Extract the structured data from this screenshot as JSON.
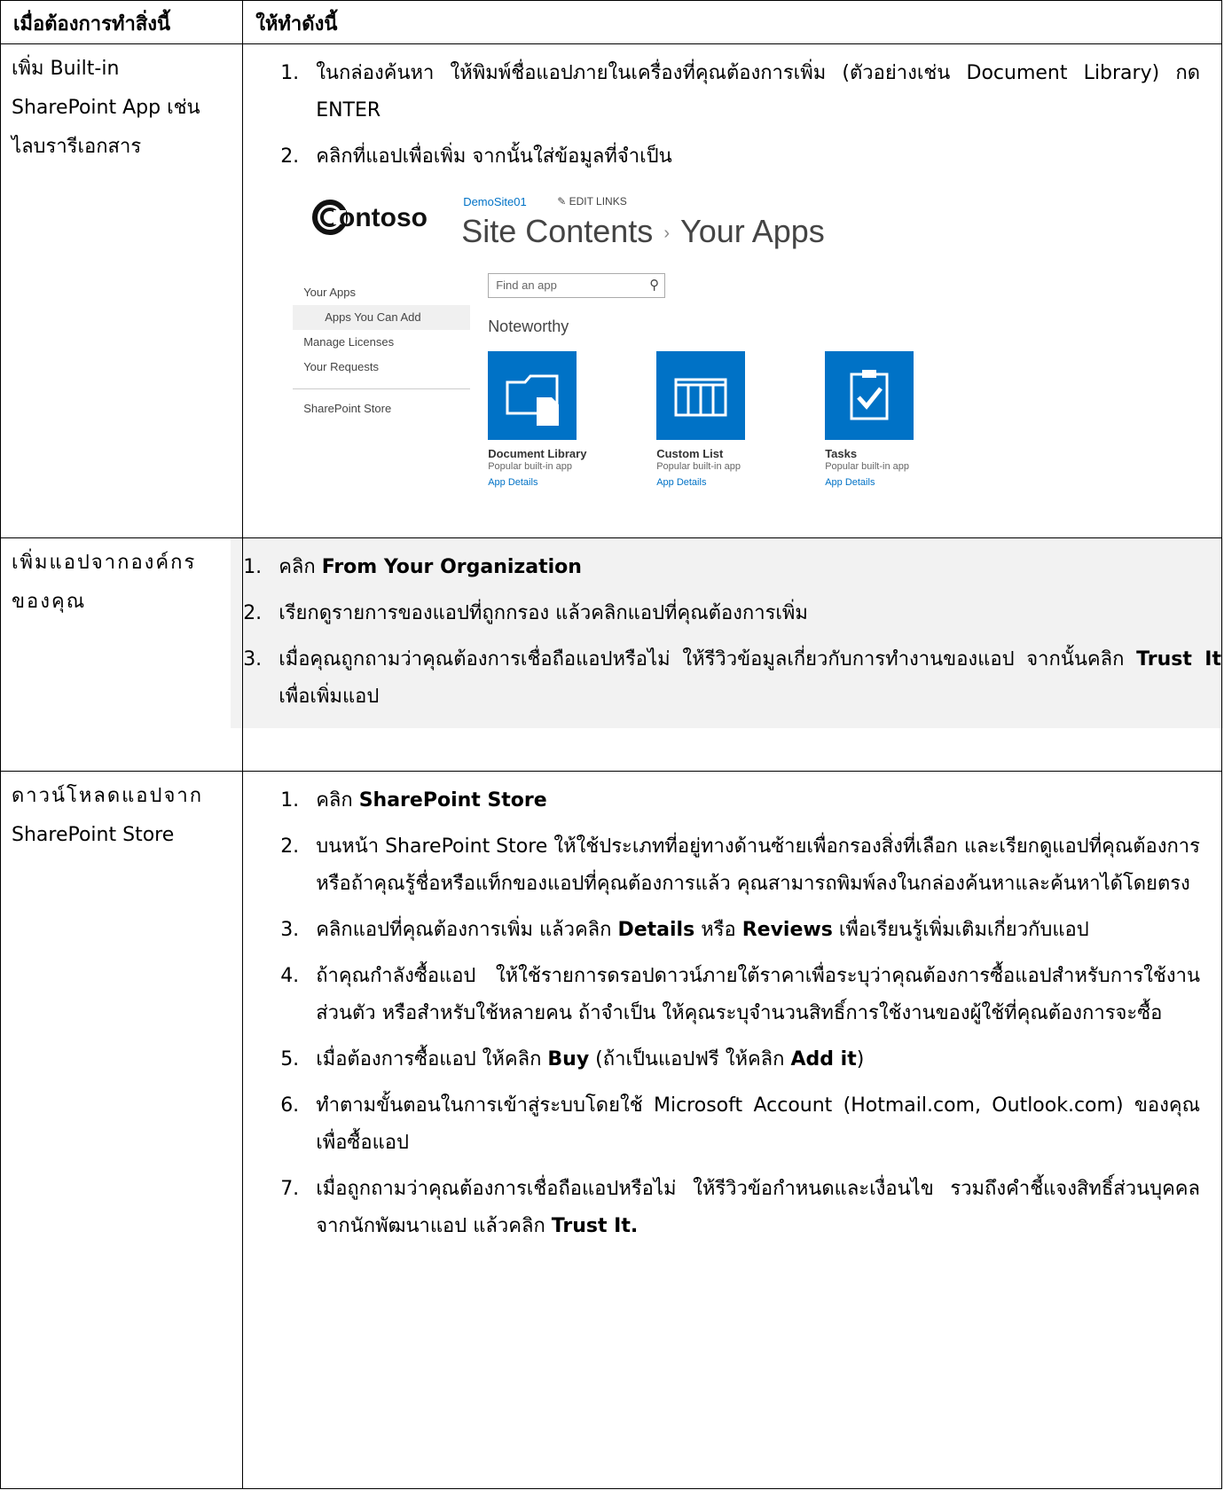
{
  "header": {
    "col1": "เมื่อต้องการทำสิ่งนี้",
    "col2": "ให้ทำดังนี้"
  },
  "rows": [
    {
      "what": [
        "เพิ่ม Built-in",
        "SharePoint App เช่น",
        "ไลบรารีเอกสาร"
      ],
      "steps": [
        {
          "num": "1.",
          "text": "ในกล่องค้นหา ให้พิมพ์ชื่อแอปภายในเครื่องที่คุณต้องการเพิ่ม (ตัวอย่างเช่น Document Library) กด ENTER"
        },
        {
          "num": "2.",
          "text": "คลิกที่แอปเพื่อเพิ่ม จากนั้นใส่ข้อมูลที่จำเป็น"
        }
      ]
    },
    {
      "what": [
        "เพิ่มแอปจากองค์กร",
        "ของคุณ"
      ],
      "steps": [
        {
          "num": "1.",
          "pre": "คลิก ",
          "bold": "From Your Organization",
          "post": ""
        },
        {
          "num": "2.",
          "pre": "เรียกดูรายการของแอปที่ถูกกรอง แล้วคลิกแอปที่คุณต้องการเพิ่ม",
          "bold": "",
          "post": ""
        },
        {
          "num": "3.",
          "pre": "เมื่อคุณถูกถามว่าคุณต้องการเชื่อถือแอปหรือไม่ ให้รีวิวข้อมูลเกี่ยวกับการทำงานของแอป จากนั้นคลิก ",
          "bold": "Trust It",
          "post": " เพื่อเพิ่มแอป"
        }
      ]
    },
    {
      "what": [
        "ดาวน์โหลดแอปจาก",
        "SharePoint Store"
      ],
      "steps": [
        {
          "num": "1.",
          "pre": "คลิก ",
          "bold": "SharePoint Store",
          "post": ""
        },
        {
          "num": "2.",
          "pre": "บนหน้า SharePoint Store ให้ใช้ประเภทที่อยู่ทางด้านซ้ายเพื่อกรองสิ่งที่เลือก และเรียกดูแอปที่คุณต้องการ",
          "bold": "",
          "post": "",
          "extra": "หรือถ้าคุณรู้ชื่อหรือแท็กของแอปที่คุณต้องการแล้ว คุณสามารถพิมพ์ลงในกล่องค้นหาและค้นหาได้โดยตรง"
        },
        {
          "num": "3.",
          "pre": "คลิกแอปที่คุณต้องการเพิ่ม แล้วคลิก ",
          "bold": "Details",
          "mid": " หรือ ",
          "bold2": "Reviews",
          "post": " เพื่อเรียนรู้เพิ่มเติมเกี่ยวกับแอป"
        },
        {
          "num": "4.",
          "pre": "ถ้าคุณกำลังซื้อแอป ให้ใช้รายการดรอปดาวน์ภายใต้ราคาเพื่อระบุว่าคุณต้องการซื้อแอปสำหรับการใช้งานส่วนตัว หรือสำหรับใช้หลายคน ถ้าจำเป็น ให้คุณระบุจำนวนสิทธิ์การใช้งานของผู้ใช้ที่คุณต้องการจะซื้อ",
          "bold": "",
          "post": ""
        },
        {
          "num": "5.",
          "pre": "เมื่อต้องการซื้อแอป ให้คลิก ",
          "bold": "Buy",
          "mid": " (ถ้าเป็นแอปฟรี ให้คลิก ",
          "bold2": "Add it",
          "post": ")"
        },
        {
          "num": "6.",
          "pre": "ทำตามขั้นตอนในการเข้าสู่ระบบโดยใช้ Microsoft Account (Hotmail.com, Outlook.com) ของคุณเพื่อซื้อแอป",
          "bold": "",
          "post": ""
        },
        {
          "num": "7.",
          "pre": "เมื่อถูกถามว่าคุณต้องการเชื่อถือแอปหรือไม่ ให้รีวิวข้อกำหนดและเงื่อนไข รวมถึงคำชี้แจงสิทธิ์ส่วนบุคคลจากนักพัฒนาแอป แล้วคลิก ",
          "bold": "Trust It.",
          "post": ""
        }
      ]
    }
  ],
  "sharepoint": {
    "logo_text": "ontoso",
    "site": "DemoSite01",
    "edit_links": "EDIT LINKS",
    "title_a": "Site Contents",
    "title_sep": "›",
    "title_b": "Your Apps",
    "nav": [
      "Your Apps",
      "Apps You Can Add",
      "Manage Licenses",
      "Your Requests",
      "SharePoint Store"
    ],
    "search_placeholder": "Find an app",
    "noteworthy": "Noteworthy",
    "tiles": [
      {
        "name": "Document Library",
        "sub": "Popular built-in app",
        "link": "App Details",
        "icon": "document-library-icon"
      },
      {
        "name": "Custom List",
        "sub": "Popular built-in app",
        "link": "App Details",
        "icon": "custom-list-icon"
      },
      {
        "name": "Tasks",
        "sub": "Popular built-in app",
        "link": "App Details",
        "icon": "tasks-icon"
      }
    ],
    "brand_color": "#0072c6"
  }
}
